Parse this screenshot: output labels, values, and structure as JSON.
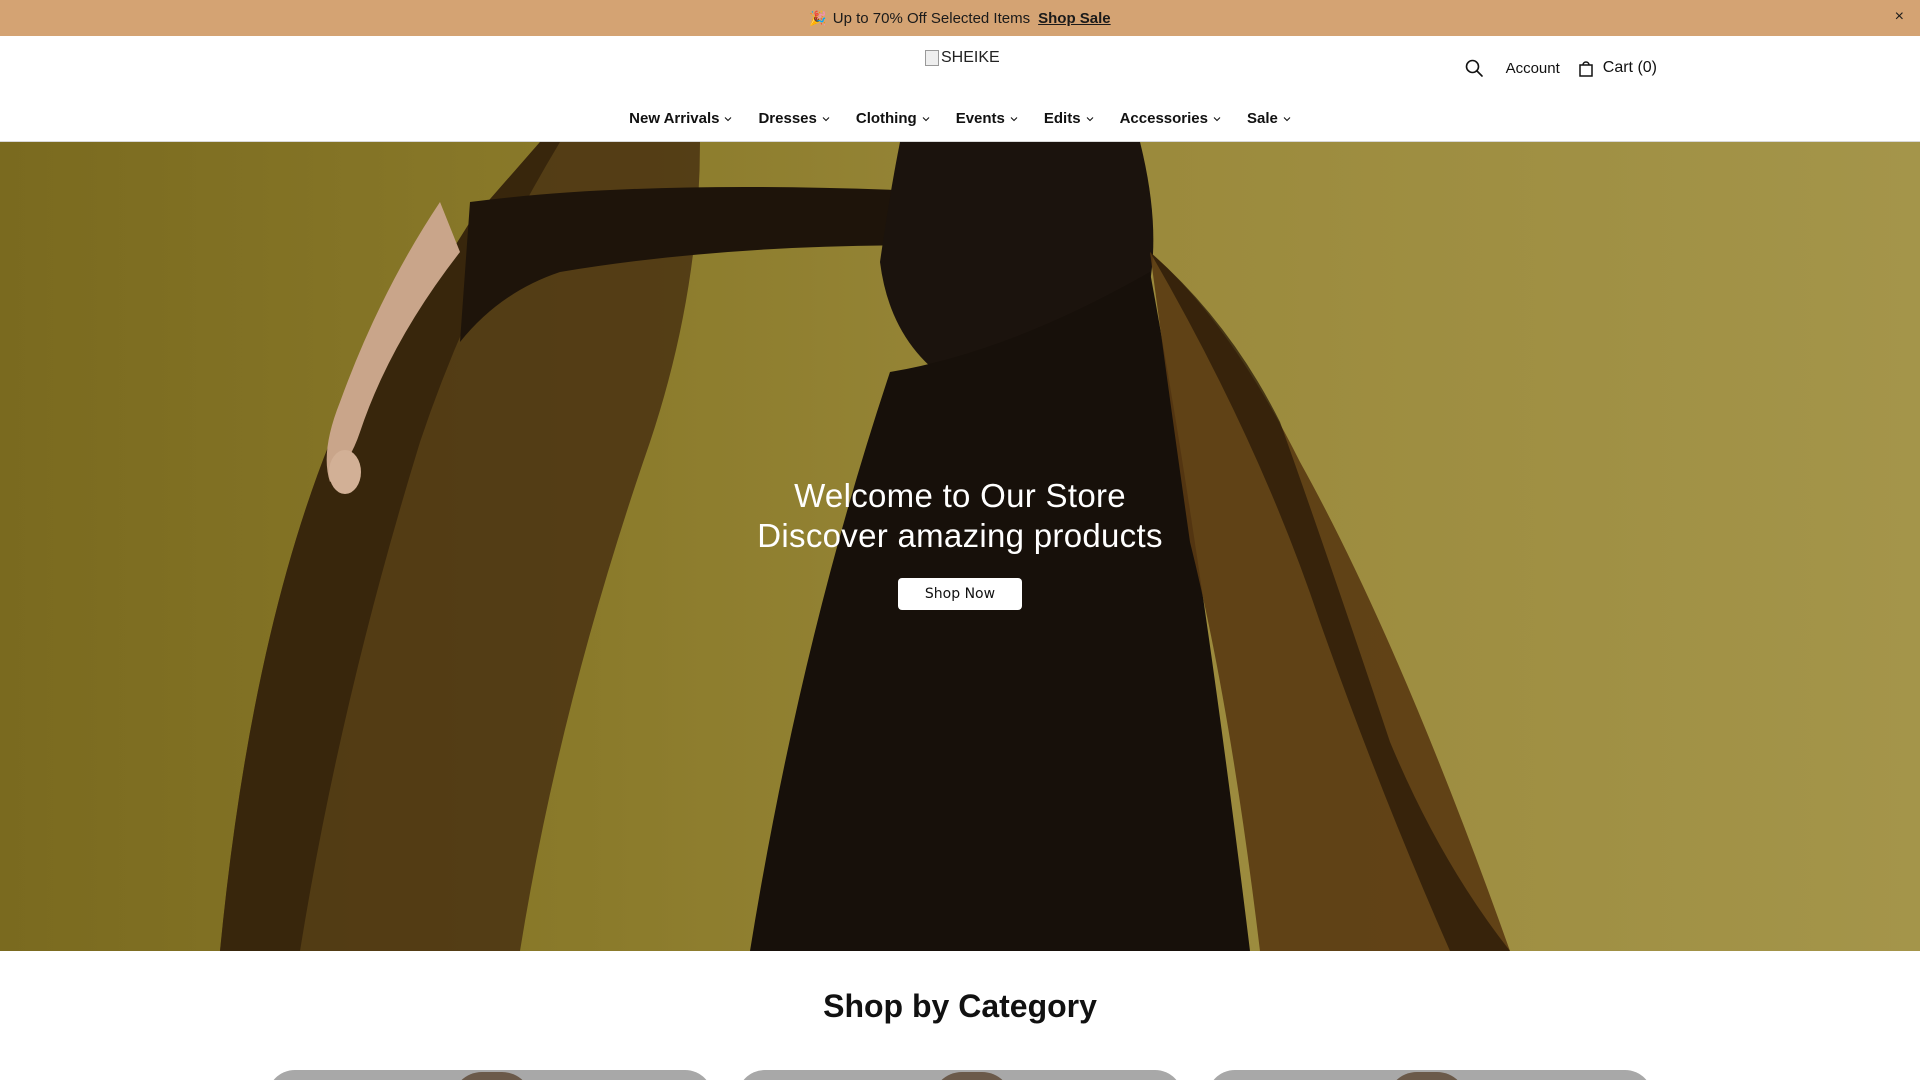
{
  "announcement": {
    "text": "Up to 70% Off Selected Items",
    "link": "Shop Sale",
    "emoji": "🎉",
    "close": "×",
    "bg_color": "#d4a373"
  },
  "header": {
    "logo_alt": "SHEIKE",
    "account": "Account",
    "cart": "Cart (0)",
    "icons": [
      "search-icon",
      "cart-icon"
    ]
  },
  "nav": {
    "items": [
      "New Arrivals",
      "Dresses",
      "Clothing",
      "Events",
      "Edits",
      "Accessories",
      "Sale"
    ]
  },
  "hero": {
    "title": "Welcome to Our Store",
    "subtitle": "Discover amazing products",
    "button": "Shop Now",
    "bg_color": "#8f7e30"
  },
  "category": {
    "title": "Shop by Category"
  }
}
